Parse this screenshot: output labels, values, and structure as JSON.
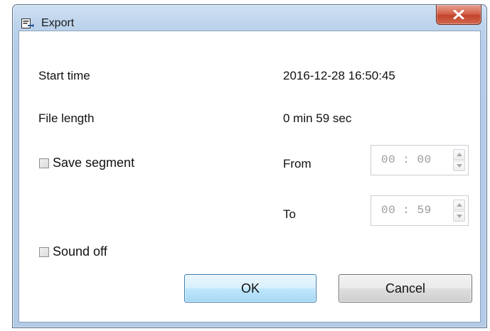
{
  "window": {
    "title": "Export",
    "close_label": "x"
  },
  "info": {
    "start_time_label": "Start time",
    "start_time_value": "2016-12-28 16:50:45",
    "file_length_label": "File length",
    "file_length_value": "0 min 59 sec"
  },
  "segment": {
    "checkbox_label": "Save segment",
    "checked": false,
    "from_label": "From",
    "from_value": "00 : 00",
    "to_label": "To",
    "to_value": "00 : 59"
  },
  "sound": {
    "checkbox_label": "Sound off",
    "checked": false
  },
  "buttons": {
    "ok_label": "OK",
    "cancel_label": "Cancel"
  },
  "icons": {
    "app": "export-icon",
    "close": "close-icon",
    "spin_up": "chevron-up-icon",
    "spin_down": "chevron-down-icon"
  },
  "colors": {
    "titlebar": "#bcd3ec",
    "close_button": "#c2432a",
    "ok_border": "#3c7fb1",
    "disabled_text": "#9a9a9a"
  }
}
